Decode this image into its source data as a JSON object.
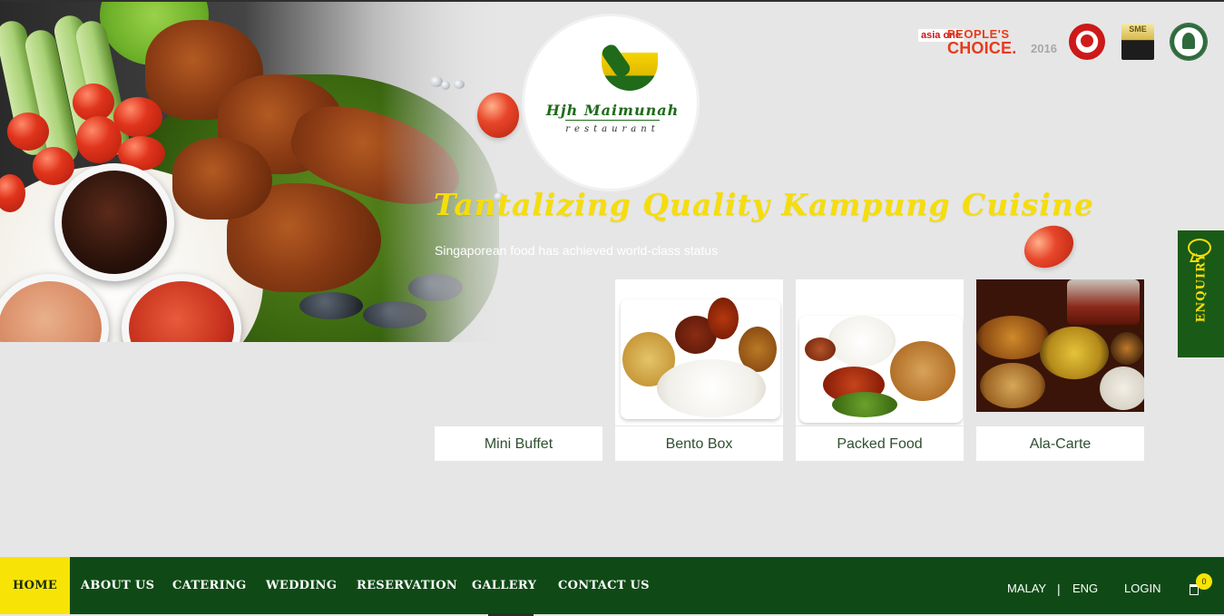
{
  "brand": {
    "logo_name": "Hjh Maimunah",
    "logo_sub": "restaurant"
  },
  "awards": {
    "asiaone": "asia one",
    "peoples": "PEOPLE'S",
    "choice": "CHOICE.",
    "year": "2016",
    "sme": "SME"
  },
  "hero": {
    "headline": "Tantalizing Quality Kampung Cuisine",
    "tagline": "Singaporean food has achieved world-class status"
  },
  "cards": [
    {
      "label": "Mini Buffet"
    },
    {
      "label": "Bento Box"
    },
    {
      "label": "Packed Food"
    },
    {
      "label": "Ala-Carte"
    }
  ],
  "enquiry": {
    "label": "ENQUIRY"
  },
  "nav": {
    "items": [
      {
        "label": "HOME"
      },
      {
        "label": "ABOUT US"
      },
      {
        "label": "CATERING"
      },
      {
        "label": "WEDDING"
      },
      {
        "label": "RESERVATION"
      },
      {
        "label": "GALLERY"
      },
      {
        "label": "CONTACT US"
      }
    ],
    "malay": "MALAY",
    "separator": "|",
    "eng": "ENG",
    "login": "LOGIN",
    "cart_count": "0"
  },
  "colors": {
    "brand_green": "#0f4a16",
    "accent_yellow": "#f7e406",
    "page_bg": "#e6e6e6"
  }
}
